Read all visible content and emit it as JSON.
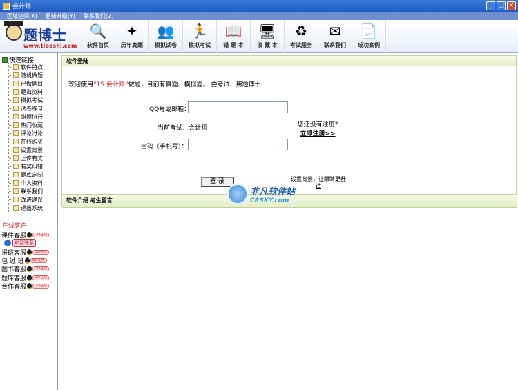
{
  "window": {
    "title": "会计师",
    "min": "_",
    "max": "□",
    "close": "×"
  },
  "menu": [
    "区域空间(X)",
    "更新升级(Y)",
    "联系我们(Z)"
  ],
  "logo": {
    "brand": "题博士",
    "url": "www.tiboshi.com"
  },
  "toolbar": [
    {
      "label": "软件首页",
      "icon": "magnifier-home-icon",
      "glyph": "🔍"
    },
    {
      "label": "历年真题",
      "icon": "arrows-icon",
      "glyph": "✦"
    },
    {
      "label": "模拟试卷",
      "icon": "people-icon",
      "glyph": "👥"
    },
    {
      "label": "模拟考试",
      "icon": "person-flag-icon",
      "glyph": "🏃"
    },
    {
      "label": "错 题 本",
      "icon": "book-icon",
      "glyph": "📖"
    },
    {
      "label": "收 藏 本",
      "icon": "computer-icon",
      "glyph": "🖥"
    },
    {
      "label": "考试服务",
      "icon": "refresh-globe-icon",
      "glyph": "♻"
    },
    {
      "label": "联系我们",
      "icon": "envelope-icon",
      "glyph": "✉"
    },
    {
      "label": "成功案例",
      "icon": "document-icon",
      "glyph": "📄"
    }
  ],
  "sidebar": {
    "root": "快速链接",
    "items": [
      "软件特点",
      "随机做题",
      "已做题目",
      "题海资料",
      "模拟考试",
      "试卷练习",
      "错题排行",
      "热门收藏",
      "评论讨论",
      "在线购买",
      "设置背景",
      "上传有奖",
      "有奖纠错",
      "题库定制",
      "个人资料",
      "联系我们",
      "改进建议",
      "退出系统"
    ],
    "online_title": "在线客户",
    "services": [
      "课件客服",
      "和我联系",
      "报班客服",
      "包 过 班",
      "图书客服",
      "题库客服",
      "合作客服"
    ],
    "qq_tag": "QQ在线"
  },
  "panel": {
    "header": "软件登陆",
    "welcome_pre": "欢迎使用",
    "welcome_quote": "“15.会计师”",
    "welcome_post": "做题，目前有真题、模拟题。 要考试，用题博士",
    "qq_label": "QQ号或邮箱：",
    "exam_label": "当前考试：",
    "exam_value": "会计师",
    "pwd_label": "密码（手机号）：",
    "no_reg": "您还没有注册?",
    "reg_link": "立即注册>>",
    "login_btn": "登 录",
    "bg_link": "设置背景，让眼睛更舒适"
  },
  "bottom_bar": "软件介绍 考生留言",
  "watermark": {
    "cn": "非凡软件站",
    "en": "CRSKY.com"
  }
}
